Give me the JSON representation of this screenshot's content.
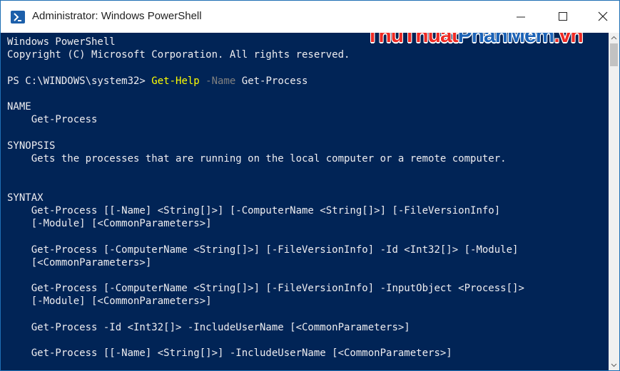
{
  "window": {
    "title": "Administrator: Windows PowerShell"
  },
  "watermark": {
    "part1": "ThuThuat",
    "part2": "PhanMem",
    "part3": ".vn"
  },
  "console": {
    "header_line1": "Windows PowerShell",
    "header_line2": "Copyright (C) Microsoft Corporation. All rights reserved.",
    "prompt": "PS C:\\WINDOWS\\system32> ",
    "command": "Get-Help",
    "param": "-Name",
    "argument": "Get-Process",
    "name_heading": "NAME",
    "name_value": "    Get-Process",
    "synopsis_heading": "SYNOPSIS",
    "synopsis_value": "    Gets the processes that are running on the local computer or a remote computer.",
    "syntax_heading": "SYNTAX",
    "syntax_lines": [
      "    Get-Process [[-Name] <String[]>] [-ComputerName <String[]>] [-FileVersionInfo]",
      "    [-Module] [<CommonParameters>]",
      "    Get-Process [-ComputerName <String[]>] [-FileVersionInfo] -Id <Int32[]> [-Module]",
      "    [<CommonParameters>]",
      "    Get-Process [-ComputerName <String[]>] [-FileVersionInfo] -InputObject <Process[]>",
      "    [-Module] [<CommonParameters>]",
      "    Get-Process -Id <Int32[]> -IncludeUserName [<CommonParameters>]",
      "    Get-Process [[-Name] <String[]>] -IncludeUserName [<CommonParameters>]"
    ]
  },
  "colors": {
    "console_background": "#012456",
    "console_text": "#eeedf0",
    "command_color": "#ffff00",
    "parameter_color": "#808080"
  }
}
